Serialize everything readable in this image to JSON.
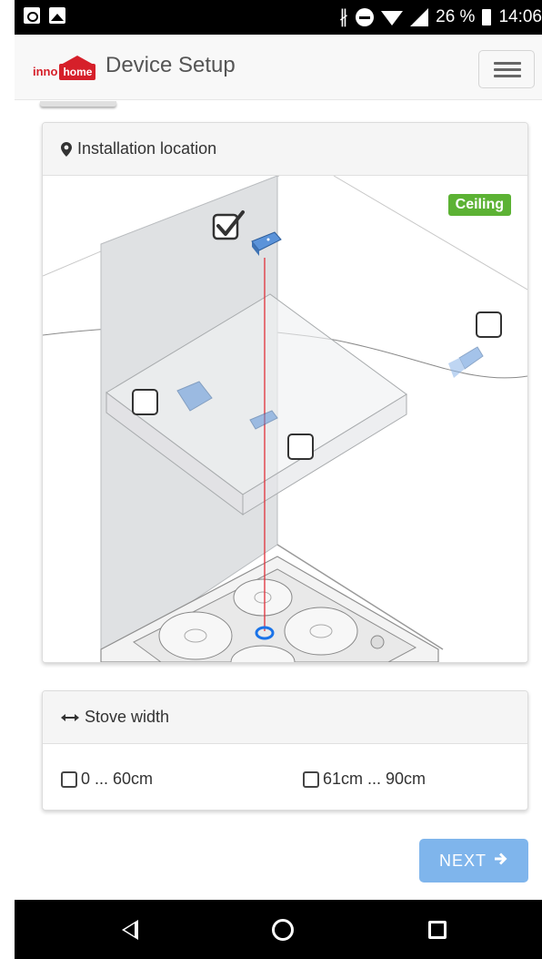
{
  "status_bar": {
    "battery": "26 %",
    "time": "14:06",
    "icons": [
      "outlook-icon",
      "image-icon",
      "bluetooth-icon",
      "do-not-disturb-icon",
      "wifi-icon",
      "signal-icon",
      "battery-icon"
    ]
  },
  "header": {
    "logo_inno": "inno",
    "logo_home": "home",
    "title": "Device Setup",
    "menu_icon": "hamburger-menu-icon"
  },
  "installation": {
    "header": "Installation location",
    "header_icon": "map-marker-icon",
    "badge": "Ceiling",
    "badge_color": "#5cb234",
    "options": [
      {
        "name": "ceiling",
        "checked": true
      },
      {
        "name": "right-wall",
        "checked": false
      },
      {
        "name": "hood-left",
        "checked": false
      },
      {
        "name": "hood-bottom",
        "checked": false
      }
    ]
  },
  "stove": {
    "header": "Stove width",
    "header_icon": "arrows-horizontal-icon",
    "options": [
      {
        "label": "0 ... 60cm",
        "checked": false
      },
      {
        "label": "61cm ... 90cm",
        "checked": false
      }
    ]
  },
  "footer": {
    "next_label": "NEXT",
    "next_icon": "arrow-right-icon",
    "next_color": "#7fb5ec"
  },
  "nav": {
    "icons": [
      "back-icon",
      "home-icon",
      "recents-icon"
    ]
  }
}
